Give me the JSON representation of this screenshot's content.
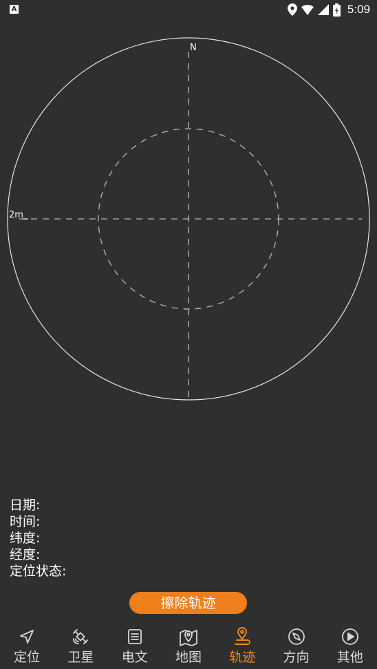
{
  "status_bar": {
    "app_badge": "A",
    "time": "5:09"
  },
  "track_view": {
    "north_label": "N",
    "scale_label": "2m"
  },
  "info": {
    "date_label": "日期:",
    "time_label": "时间:",
    "latitude_label": "纬度:",
    "longitude_label": "经度:",
    "status_label": "定位状态:"
  },
  "erase_button_label": "擦除轨迹",
  "nav": {
    "active": "track",
    "items": [
      {
        "id": "locate",
        "label": "定位",
        "icon": "navigation-arrow-icon"
      },
      {
        "id": "satellite",
        "label": "卫星",
        "icon": "satellite-icon"
      },
      {
        "id": "message",
        "label": "电文",
        "icon": "document-list-icon"
      },
      {
        "id": "map",
        "label": "地图",
        "icon": "map-pin-icon"
      },
      {
        "id": "track",
        "label": "轨迹",
        "icon": "location-track-icon"
      },
      {
        "id": "direction",
        "label": "方向",
        "icon": "compass-icon"
      },
      {
        "id": "other",
        "label": "其他",
        "icon": "play-circle-icon"
      }
    ]
  },
  "colors": {
    "background": "#2f2f2f",
    "accent": "#ef7f1a",
    "active_nav": "#ef8b1e",
    "inactive_nav": "#d8d8d8",
    "dashed_lines": "#bdbdbd"
  }
}
